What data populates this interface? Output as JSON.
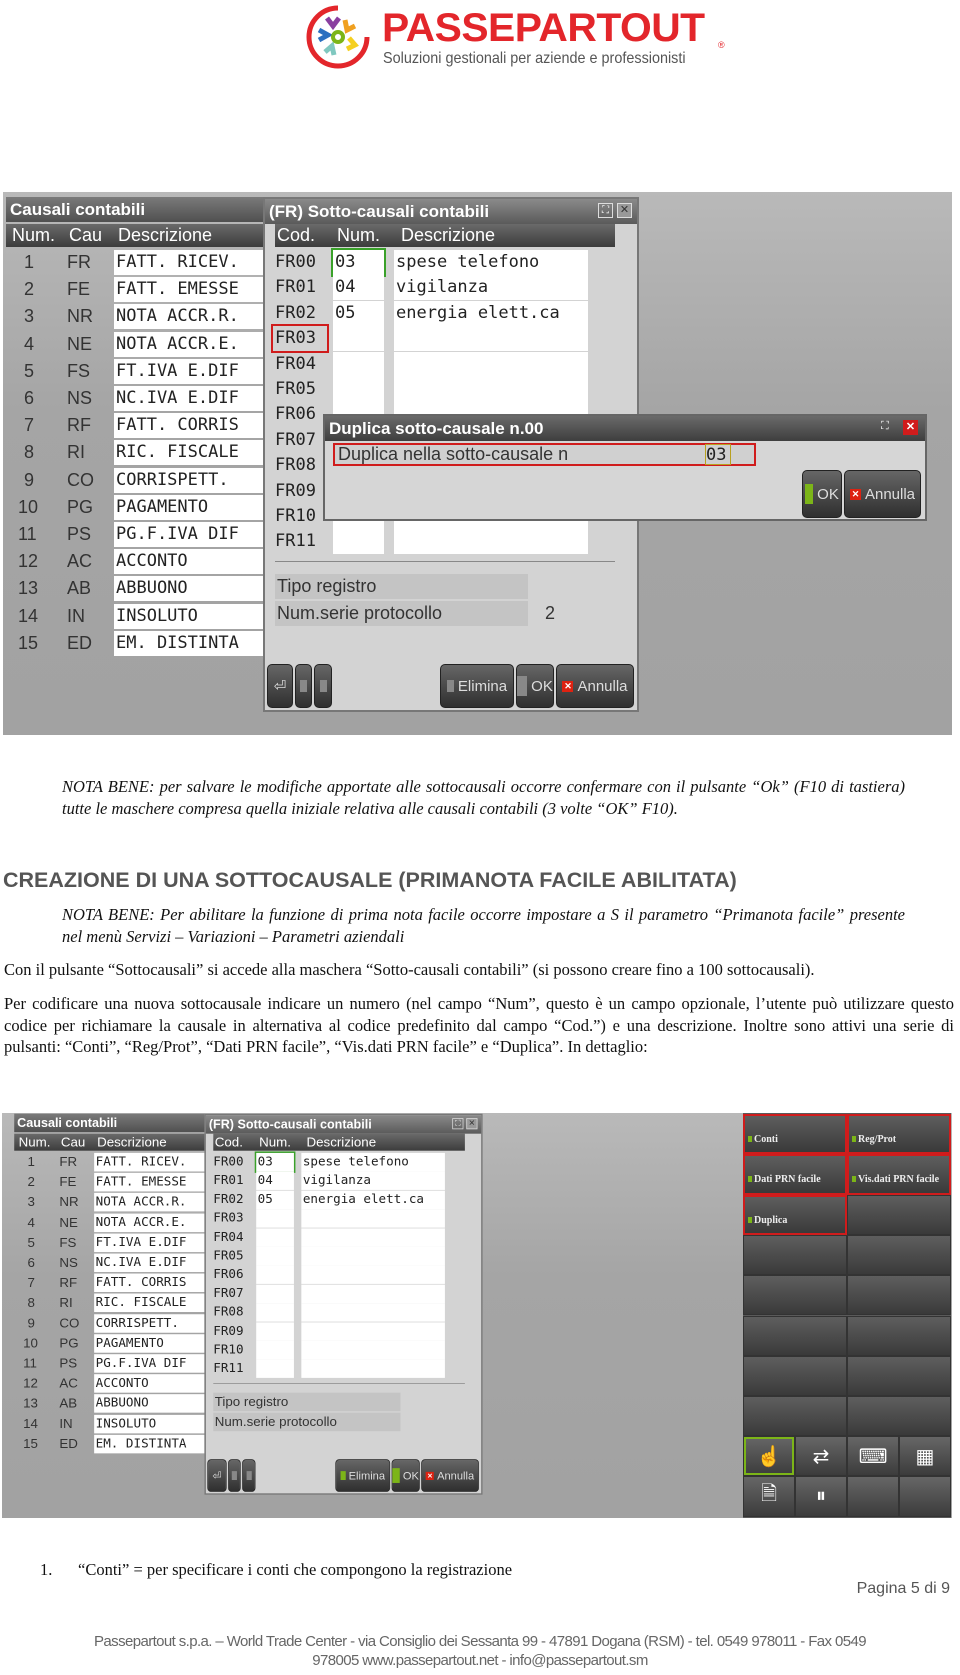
{
  "logo": {
    "brand": "PASSEPARTOUT",
    "tagline": "Soluzioni gestionali per aziende e professionisti",
    "registered": "®"
  },
  "screen1": {
    "left_title": "Causali contabili",
    "left_headers": [
      "Num.",
      "Cau",
      "Descrizione"
    ],
    "rows": [
      {
        "num": "1",
        "cau": "FR",
        "desc": "FATT. RICEV."
      },
      {
        "num": "2",
        "cau": "FE",
        "desc": "FATT. EMESSE"
      },
      {
        "num": "3",
        "cau": "NR",
        "desc": "NOTA ACCR.R."
      },
      {
        "num": "4",
        "cau": "NE",
        "desc": "NOTA ACCR.E."
      },
      {
        "num": "5",
        "cau": "FS",
        "desc": "FT.IVA E.DIF"
      },
      {
        "num": "6",
        "cau": "NS",
        "desc": "NC.IVA E.DIF"
      },
      {
        "num": "7",
        "cau": "RF",
        "desc": "FATT. CORRIS"
      },
      {
        "num": "8",
        "cau": "RI",
        "desc": "RIC. FISCALE"
      },
      {
        "num": "9",
        "cau": "CO",
        "desc": "CORRISPETT."
      },
      {
        "num": "10",
        "cau": "PG",
        "desc": "PAGAMENTO"
      },
      {
        "num": "11",
        "cau": "PS",
        "desc": "PG.F.IVA DIF"
      },
      {
        "num": "12",
        "cau": "AC",
        "desc": "ACCONTO"
      },
      {
        "num": "13",
        "cau": "AB",
        "desc": "ABBUONO"
      },
      {
        "num": "14",
        "cau": "IN",
        "desc": "INSOLUTO"
      },
      {
        "num": "15",
        "cau": "ED",
        "desc": "EM. DISTINTA"
      }
    ],
    "window_title": "(FR) Sotto-causali contabili",
    "window_headers": [
      "Cod.",
      "Num.",
      "Descrizione"
    ],
    "sub_rows": [
      {
        "cod": "FR00",
        "num": "03",
        "desc": "spese telefono"
      },
      {
        "cod": "FR01",
        "num": "04",
        "desc": "vigilanza"
      },
      {
        "cod": "FR02",
        "num": "05",
        "desc": "energia elett.ca"
      },
      {
        "cod": "FR03",
        "num": "",
        "desc": ""
      },
      {
        "cod": "FR04",
        "num": "",
        "desc": ""
      },
      {
        "cod": "FR05",
        "num": "",
        "desc": ""
      },
      {
        "cod": "FR06",
        "num": "",
        "desc": ""
      },
      {
        "cod": "FR07",
        "num": "",
        "desc": ""
      },
      {
        "cod": "FR08",
        "num": "",
        "desc": ""
      },
      {
        "cod": "FR09",
        "num": "",
        "desc": ""
      },
      {
        "cod": "FR10",
        "num": "",
        "desc": ""
      },
      {
        "cod": "FR11",
        "num": "",
        "desc": ""
      }
    ],
    "tipo_registro_label": "Tipo registro",
    "num_serie_label": "Num.serie protocollo",
    "num_serie_value": "2",
    "buttons": {
      "elimina": "Elimina",
      "ok": "OK",
      "annulla": "Annulla"
    },
    "dialog": {
      "title": "Duplica sotto-causale n.00",
      "field_label": "Duplica nella sotto-causale n",
      "field_value": "03",
      "ok": "OK",
      "annulla": "Annulla"
    }
  },
  "screen2": {
    "side_buttons": [
      "Conti",
      "Reg/Prot",
      "Dati PRN facile",
      "Vis.dati PRN facile",
      "Duplica"
    ],
    "icons": [
      "hand-pointer-icon",
      "transfer-icon",
      "keyboard-icon",
      "keypad-icon",
      "document-search-icon",
      "pause-icon"
    ]
  },
  "text": {
    "nota1_label": "NOTA BENE",
    "nota1": ": per salvare le modifiche apportate alle sottocausali occorre confermare con il pulsante “Ok” (F10 di tastiera) tutte le maschere compresa quella iniziale relativa alle causali contabili (3 volte “OK” F10).",
    "heading": "CREAZIONE DI UNA SOTTOCAUSALE (PRIMANOTA FACILE ABILITATA)",
    "nota2_label": "NOTA BENE",
    "nota2": ": Per abilitare la funzione di prima nota facile occorre impostare a S il parametro “Primanota facile” presente nel menù Servizi – Variazioni – Parametri aziendali",
    "para1": "Con il pulsante “Sottocausali” si accede alla maschera “Sotto-causali contabili” (si possono creare fino a 100 sottocausali).",
    "para2": "Per codificare una nuova sottocausale indicare un numero (nel campo “Num”, questo è un campo opzionale, l’utente può utilizzare questo codice per richiamare la causale in alternativa al codice predefinito dal campo “Cod.”) e una descrizione. Inoltre sono attivi una serie di pulsanti: “Conti”, “Reg/Prot”, “Dati PRN facile”, “Vis.dati PRN facile” e “Duplica”. In dettaglio:",
    "list_num": "1.",
    "list_item": "“Conti” = per specificare i conti che compongono la registrazione"
  },
  "footer": {
    "page": "Pagina 5 di 9",
    "line1": "Passepartout s.p.a. – World Trade Center - via Consiglio dei Sessanta 99 - 47891 Dogana (RSM) - tel. 0549 978011 - Fax 0549",
    "line2": "978005 www.passepartout.net - info@passepartout.sm"
  },
  "colors": {
    "brand": "#e3262b",
    "highlight_red": "#d01c1c",
    "highlight_green": "#3aa12a",
    "heading": "#555555"
  }
}
